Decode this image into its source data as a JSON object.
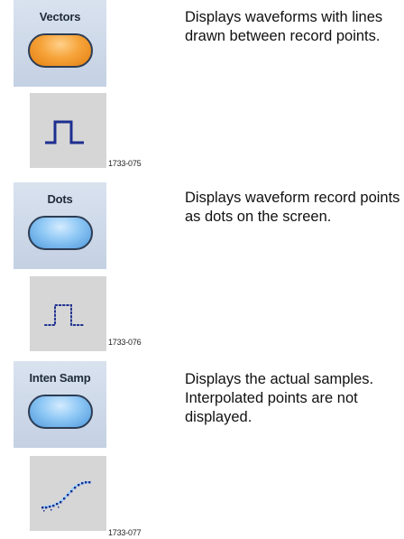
{
  "modes": [
    {
      "button_label": "Vectors",
      "button_state": "selected",
      "button_color": "#f29a2e",
      "icon": "vectors-waveform-icon",
      "figure_code": "1733-075",
      "description": "Displays waveforms with lines drawn between record points."
    },
    {
      "button_label": "Dots",
      "button_state": "unselected",
      "button_color": "#7fbdf0",
      "icon": "dots-waveform-icon",
      "figure_code": "1733-076",
      "description": "Displays waveform record points as dots on the screen."
    },
    {
      "button_label": "Inten Samp",
      "button_state": "unselected",
      "button_color": "#7fbdf0",
      "icon": "inten-samp-waveform-icon",
      "figure_code": "1733-077",
      "description": "Displays the actual samples. Interpolated points are not displayed."
    }
  ]
}
